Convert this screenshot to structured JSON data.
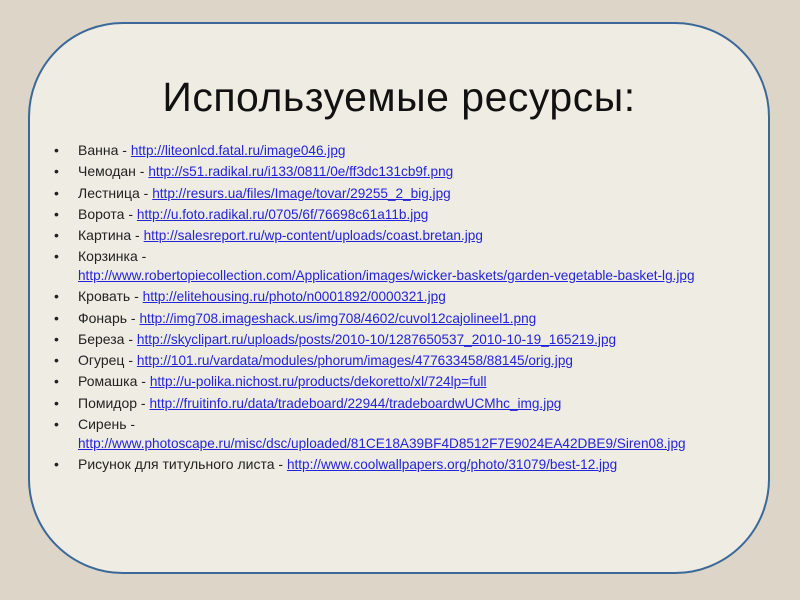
{
  "title": "Используемые ресурсы:",
  "items": [
    {
      "label": "Ванна",
      "url": "http://liteonlcd.fatal.ru/image046.jpg"
    },
    {
      "label": "Чемодан",
      "url": "http://s51.radikal.ru/i133/0811/0e/ff3dc131cb9f.png"
    },
    {
      "label": "Лестница",
      "url": "http://resurs.ua/files/Image/tovar/29255_2_big.jpg"
    },
    {
      "label": "Ворота",
      "url": "http://u.foto.radikal.ru/0705/6f/76698c61a11b.jpg"
    },
    {
      "label": "Картина",
      "url": "http://salesreport.ru/wp-content/uploads/coast.bretan.jpg"
    },
    {
      "label": "Корзинка",
      "url": "http://www.robertopiecollection.com/Application/images/wicker-baskets/garden-vegetable-basket-lg.jpg"
    },
    {
      "label": "Кровать",
      "url": "http://elitehousing.ru/photo/n0001892/0000321.jpg"
    },
    {
      "label": "Фонарь",
      "url": "http://img708.imageshack.us/img708/4602/cuvol12cajolineel1.png"
    },
    {
      "label": "Береза",
      "url": "http://skyclipart.ru/uploads/posts/2010-10/1287650537_2010-10-19_165219.jpg"
    },
    {
      "label": "Огурец",
      "url": "http://101.ru/vardata/modules/phorum/images/477633458/88145/orig.jpg"
    },
    {
      "label": "Ромашка",
      "url": "http://u-polika.nichost.ru/products/dekoretto/xl/724lp=full"
    },
    {
      "label": "Помидор",
      "url": "http://fruitinfo.ru/data/tradeboard/22944/tradeboardwUCMhc_img.jpg"
    },
    {
      "label": "Сирень",
      "url": "http://www.photoscape.ru/misc/dsc/uploaded/81CE18A39BF4D8512F7E9024EA42DBE9/Siren08.jpg"
    },
    {
      "label": "Рисунок для титульного листа",
      "url": "http://www.coolwallpapers.org/photo/31079/best-12.jpg"
    }
  ]
}
